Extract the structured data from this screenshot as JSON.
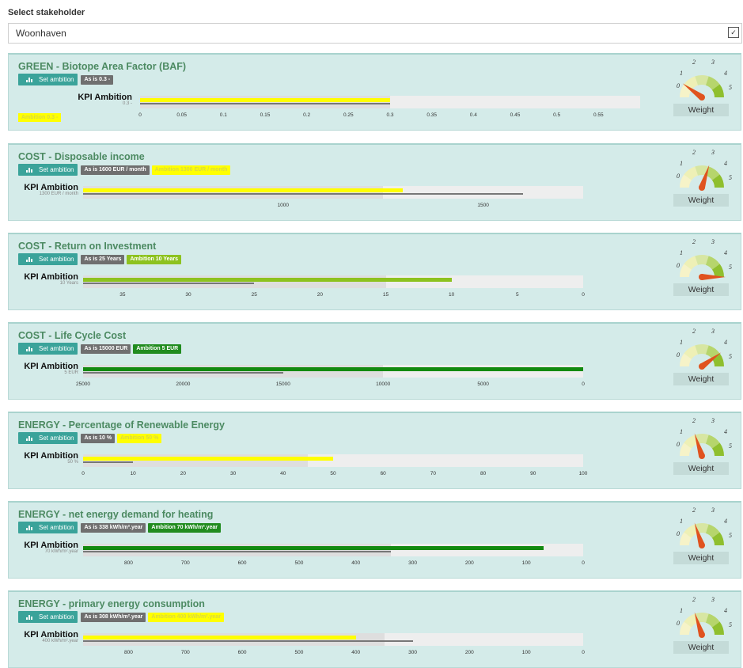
{
  "stakeholder": {
    "label": "Select stakeholder",
    "value": "Woonhaven",
    "arrow": "✓"
  },
  "set_ambition_label": "Set ambition",
  "kpi_label": "KPI Ambition",
  "weight_label": "Weight",
  "gauge_labels": [
    "0",
    "1",
    "2",
    "3",
    "4",
    "5"
  ],
  "panels": [
    {
      "title": "GREEN - Biotope Area Factor (BAF)",
      "asis": "As is 0.3 -",
      "ambition": "Ambition 0.3 -",
      "sub": "0.3 -",
      "ambition_color": "yellow",
      "ambition_tag_position": "below",
      "axis_min": 0,
      "axis_max": 0.6,
      "track_max": 0.6,
      "asis_value": 0.3,
      "ambition_value": 0.3,
      "ticks": [
        "0",
        "0.05",
        "0.1",
        "0.15",
        "0.2",
        "0.25",
        "0.3",
        "0.35",
        "0.4",
        "0.45",
        "0.5",
        "0.55"
      ],
      "tick_values": [
        0,
        0.05,
        0.1,
        0.15,
        0.2,
        0.25,
        0.3,
        0.35,
        0.4,
        0.45,
        0.5,
        0.55
      ],
      "weight": 1
    },
    {
      "title": "COST - Disposable income",
      "asis": "As is 1600 EUR / month",
      "ambition": "Ambition 1300 EUR / month",
      "sub": "1300 EUR / month",
      "ambition_color": "yellow",
      "axis_min": 500,
      "axis_max": 1750,
      "band_value": 1250,
      "asis_value": 1600,
      "ambition_value": 1300,
      "ticks": [
        "1000",
        "1500"
      ],
      "tick_values": [
        1000,
        1500
      ],
      "weight": 3
    },
    {
      "title": "COST - Return on Investment",
      "asis": "As is 25 Years",
      "ambition": "Ambition 10 Years",
      "sub": "10 Years",
      "ambition_color": "lgreen",
      "axis_min": 38,
      "axis_max": 0,
      "band_value": 15,
      "asis_value": 25,
      "ambition_value": 10,
      "ticks": [
        "35",
        "30",
        "25",
        "20",
        "15",
        "10",
        "5",
        "0"
      ],
      "tick_values": [
        35,
        30,
        25,
        20,
        15,
        10,
        5,
        0
      ],
      "weight": 5
    },
    {
      "title": "COST - Life Cycle Cost",
      "asis": "As is 15000 EUR",
      "ambition": "Ambition 5 EUR",
      "sub": "5 EUR",
      "ambition_color": "dgreen",
      "axis_min": 25000,
      "axis_max": 0,
      "band_value": 10000,
      "asis_value": 15000,
      "ambition_value": 0,
      "ticks": [
        "25000",
        "20000",
        "15000",
        "10000",
        "5000",
        "0"
      ],
      "tick_values": [
        25000,
        20000,
        15000,
        10000,
        5000,
        0
      ],
      "weight": 4
    },
    {
      "title": "ENERGY - Percentage of Renewable Energy",
      "asis": "As is 10 %",
      "ambition": "Ambition 50 %",
      "sub": "50 %",
      "ambition_color": "yellow",
      "axis_min": 0,
      "axis_max": 100,
      "band_value": 45,
      "asis_value": 10,
      "ambition_value": 50,
      "ticks": [
        "0",
        "10",
        "20",
        "30",
        "40",
        "50",
        "60",
        "70",
        "80",
        "90",
        "100"
      ],
      "tick_values": [
        0,
        10,
        20,
        30,
        40,
        50,
        60,
        70,
        80,
        90,
        100
      ],
      "weight": 2
    },
    {
      "title": "ENERGY - net energy demand for heating",
      "asis": "As is 338 kWh/m².year",
      "ambition": "Ambition 70 kWh/m².year",
      "sub": "70 kWh/m².year",
      "ambition_color": "dgreen",
      "axis_min": 880,
      "axis_max": 0,
      "band_value": 338,
      "asis_value": 338,
      "ambition_value": 70,
      "ticks": [
        "800",
        "700",
        "600",
        "500",
        "400",
        "300",
        "200",
        "100",
        "0"
      ],
      "tick_values": [
        800,
        700,
        600,
        500,
        400,
        300,
        200,
        100,
        0
      ],
      "weight": 2
    },
    {
      "title": "ENERGY - primary energy consumption",
      "asis": "As is 308 kWh/m².year",
      "ambition": "Ambition 400 kWh/m².year",
      "sub": "400 kWh/m².year",
      "ambition_color": "yellow",
      "axis_min": 880,
      "axis_max": 0,
      "band_value": 350,
      "asis_value": 300,
      "ambition_value": 400,
      "ticks": [
        "800",
        "700",
        "600",
        "500",
        "400",
        "300",
        "200",
        "100",
        "0"
      ],
      "tick_values": [
        800,
        700,
        600,
        500,
        400,
        300,
        200,
        100,
        0
      ],
      "weight": 2
    }
  ],
  "colors": {
    "yellow": "#ffff00",
    "lgreen": "#8dc21f",
    "dgreen": "#138a10",
    "needle": "#e0531f",
    "title": "#4c8a62",
    "panel": "#d4ebe9"
  }
}
